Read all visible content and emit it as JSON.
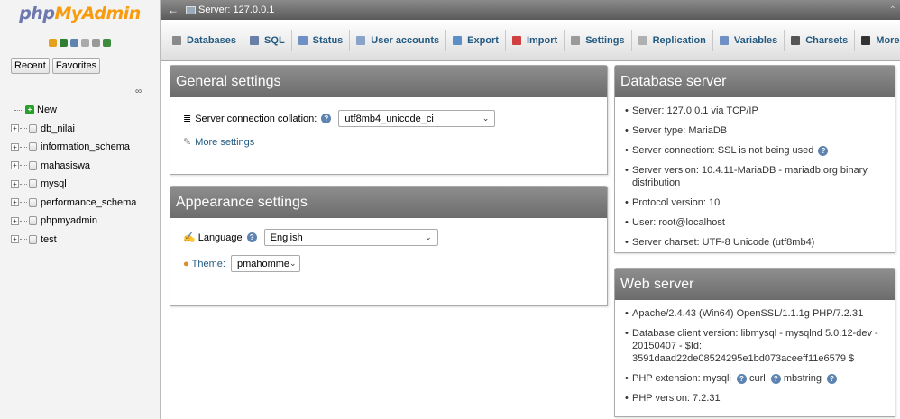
{
  "nav": {
    "logo_php": "php",
    "logo_myadmin": "MyAdmin",
    "toolbar_icons": [
      {
        "name": "home-icon",
        "color": "#e5a11a"
      },
      {
        "name": "logout-icon",
        "color": "#2f7d32"
      },
      {
        "name": "help-icon",
        "color": "#5d84b0"
      },
      {
        "name": "docs-icon",
        "color": "#aaaaaa"
      },
      {
        "name": "settings-icon",
        "color": "#999999"
      },
      {
        "name": "reload-icon",
        "color": "#3d8b3d"
      }
    ],
    "recent_tab": "Recent",
    "favorites_tab": "Favorites",
    "link_icon": "∞",
    "tree_new": "New",
    "databases": [
      "db_nilai",
      "information_schema",
      "mahasiswa",
      "mysql",
      "performance_schema",
      "phpmyadmin",
      "test"
    ]
  },
  "topbar": {
    "collapse": "←",
    "server_label": "Server: 127.0.0.1",
    "right_glyph": "⌃"
  },
  "menu": [
    {
      "label": "Databases",
      "icon": "databases-icon",
      "color": "#8a8a8a"
    },
    {
      "label": "SQL",
      "icon": "sql-icon",
      "color": "#6a7fa8"
    },
    {
      "label": "Status",
      "icon": "status-icon",
      "color": "#6f90c5"
    },
    {
      "label": "User accounts",
      "icon": "user-accounts-icon",
      "color": "#8aa3c8"
    },
    {
      "label": "Export",
      "icon": "export-icon",
      "color": "#5a8fc8"
    },
    {
      "label": "Import",
      "icon": "import-icon",
      "color": "#d04040"
    },
    {
      "label": "Settings",
      "icon": "settings-wrench-icon",
      "color": "#9a9a9a"
    },
    {
      "label": "Replication",
      "icon": "replication-icon",
      "color": "#b0b0b0"
    },
    {
      "label": "Variables",
      "icon": "variables-icon",
      "color": "#6f90c5"
    },
    {
      "label": "Charsets",
      "icon": "charsets-icon",
      "color": "#555555"
    },
    {
      "label": "More",
      "icon": "more-chevron-icon",
      "color": "#333333"
    }
  ],
  "general": {
    "title": "General settings",
    "collation_label": "Server connection collation:",
    "collation_value": "utf8mb4_unicode_ci",
    "more_settings": "More settings"
  },
  "appearance": {
    "title": "Appearance settings",
    "language_label": "Language",
    "language_value": "English",
    "theme_label": "Theme:",
    "theme_value": "pmahomme"
  },
  "db_server": {
    "title": "Database server",
    "items": [
      "Server: 127.0.0.1 via TCP/IP",
      "Server type: MariaDB",
      "Server connection: SSL is not being used",
      "Server version: 10.4.11-MariaDB - mariadb.org binary distribution",
      "Protocol version: 10",
      "User: root@localhost",
      "Server charset: UTF-8 Unicode (utf8mb4)"
    ]
  },
  "web_server": {
    "title": "Web server",
    "apache": "Apache/2.4.43 (Win64) OpenSSL/1.1.1g PHP/7.2.31",
    "db_client": "Database client version: libmysql - mysqlnd 5.0.12-dev - 20150407 - $Id: 3591daad22de08524295e1bd073aceeff11e6579 $",
    "php_ext_label": "PHP extension: mysqli",
    "php_ext_curl": "curl",
    "php_ext_mbstring": "mbstring",
    "php_version": "PHP version: 7.2.31"
  }
}
